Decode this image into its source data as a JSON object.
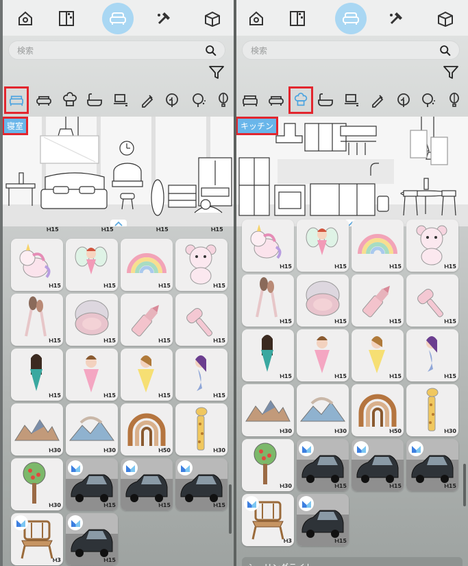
{
  "search": {
    "placeholder": "検索"
  },
  "nav_icons": [
    "home-icon",
    "room-layout-icon",
    "sofa-icon",
    "tools-icon",
    "storage-box-icon"
  ],
  "category_icons": [
    "bed-icon",
    "sofa-icon",
    "kitchen-icon",
    "bathtub-icon",
    "desk-icon",
    "pen-icon",
    "plant-icon",
    "outdoor-tree-icon",
    "balloon-icon"
  ],
  "colors": {
    "active_nav": "#a9d7f3",
    "highlight": "#e2262e",
    "label_bg": "#69b6ea"
  },
  "left_panel": {
    "selected_category": "bed",
    "room_label": "寝室",
    "items": [
      {
        "art": "unicorn",
        "price": "Ⲙ15"
      },
      {
        "art": "fairy",
        "price": "Ⲙ15"
      },
      {
        "art": "rainbow-glitter",
        "price": "Ⲙ15"
      },
      {
        "art": "teddy-bear",
        "price": "Ⲙ15"
      },
      {
        "art": "makeup-brushes",
        "price": "Ⲙ15"
      },
      {
        "art": "compact",
        "price": "Ⲙ15"
      },
      {
        "art": "lipstick",
        "price": "Ⲙ15"
      },
      {
        "art": "comb",
        "price": "Ⲙ15"
      },
      {
        "art": "princess-dark",
        "price": "Ⲙ15"
      },
      {
        "art": "princess-pink",
        "price": "Ⲙ15"
      },
      {
        "art": "princess-yellow",
        "price": "Ⲙ15"
      },
      {
        "art": "mermaid",
        "price": "Ⲙ15"
      },
      {
        "art": "mountains-brown",
        "price": "Ⲙ30"
      },
      {
        "art": "mountains-blue",
        "price": "Ⲙ30"
      },
      {
        "art": "rainbow-arch",
        "price": "Ⲙ50"
      },
      {
        "art": "giraffe",
        "price": "Ⲙ30"
      },
      {
        "art": "apple-tree",
        "price": "Ⲙ30"
      },
      {
        "art": "car",
        "price": "Ⲙ15",
        "badge": true
      },
      {
        "art": "car",
        "price": "Ⲙ15",
        "badge": true
      },
      {
        "art": "car",
        "price": "Ⲙ15",
        "badge": true
      },
      {
        "art": "chair",
        "price": "Ⲙ3",
        "badge": true
      },
      {
        "art": "car",
        "price": "Ⲙ15",
        "badge": true
      }
    ],
    "top_prices": [
      "Ⲙ15",
      "Ⲙ15",
      "Ⲙ15",
      "Ⲙ15"
    ]
  },
  "right_panel": {
    "selected_category": "kitchen",
    "room_label": "キッチン",
    "items": [
      {
        "art": "unicorn",
        "price": "Ⲙ15"
      },
      {
        "art": "fairy",
        "price": "Ⲙ15"
      },
      {
        "art": "rainbow-glitter",
        "price": "Ⲙ15"
      },
      {
        "art": "teddy-bear",
        "price": "Ⲙ15"
      },
      {
        "art": "makeup-brushes",
        "price": "Ⲙ15"
      },
      {
        "art": "compact",
        "price": "Ⲙ15"
      },
      {
        "art": "lipstick",
        "price": "Ⲙ15"
      },
      {
        "art": "comb",
        "price": "Ⲙ15"
      },
      {
        "art": "princess-dark",
        "price": "Ⲙ15"
      },
      {
        "art": "princess-pink",
        "price": "Ⲙ15"
      },
      {
        "art": "princess-yellow",
        "price": "Ⲙ15"
      },
      {
        "art": "mermaid",
        "price": "Ⲙ15"
      },
      {
        "art": "mountains-brown",
        "price": "Ⲙ30"
      },
      {
        "art": "mountains-blue",
        "price": "Ⲙ30"
      },
      {
        "art": "rainbow-arch",
        "price": "Ⲙ50"
      },
      {
        "art": "giraffe",
        "price": "Ⲙ30"
      },
      {
        "art": "apple-tree",
        "price": "Ⲙ30"
      },
      {
        "art": "car",
        "price": "Ⲙ15",
        "badge": true
      },
      {
        "art": "car",
        "price": "Ⲙ15",
        "badge": true
      },
      {
        "art": "car",
        "price": "Ⲙ15",
        "badge": true
      },
      {
        "art": "chair",
        "price": "Ⲙ3",
        "badge": true
      },
      {
        "art": "car",
        "price": "Ⲙ15",
        "badge": true
      }
    ],
    "section_header": "シーリングライト"
  }
}
